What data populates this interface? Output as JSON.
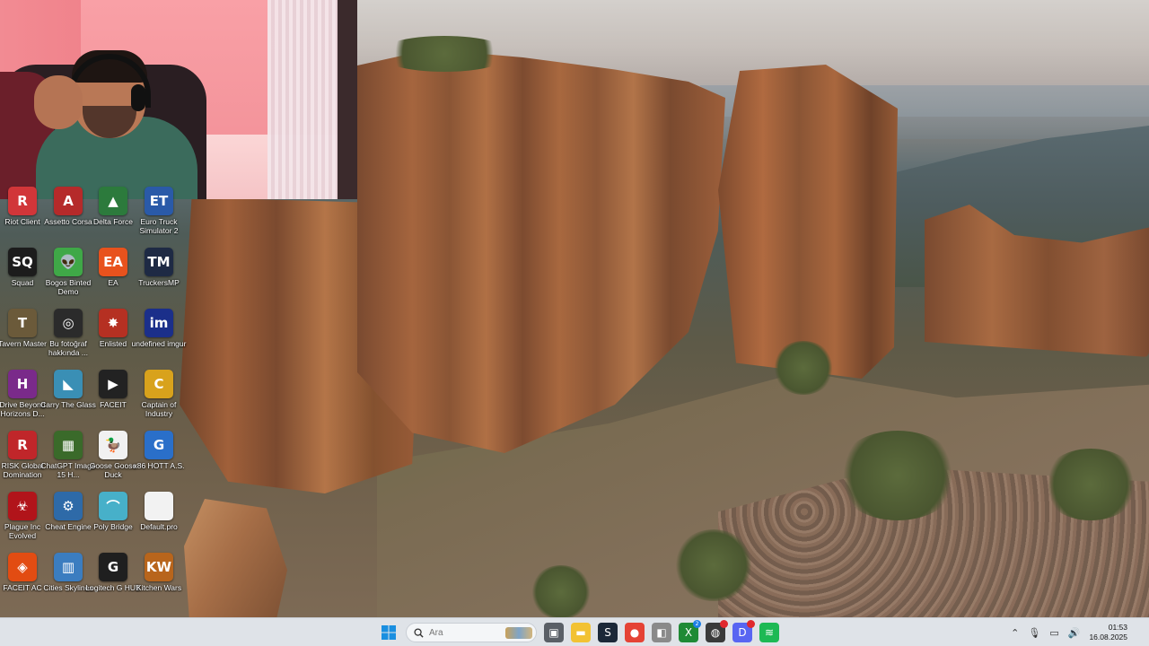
{
  "desktop_icons": [
    {
      "label": "Riot Client",
      "icon": "riot-icon",
      "color": "#d13639",
      "glyph": "R"
    },
    {
      "label": "Assetto Corsa",
      "icon": "assetto-icon",
      "color": "#b52a2a",
      "glyph": "A"
    },
    {
      "label": "Delta Force",
      "icon": "delta-force-icon",
      "color": "#2c7a3c",
      "glyph": "▲"
    },
    {
      "label": "Euro Truck Simulator 2",
      "icon": "euro-truck-icon",
      "color": "#2a5aa8",
      "glyph": "ET"
    },
    {
      "label": "Squad",
      "icon": "squad-icon",
      "color": "#1c1c1c",
      "glyph": "SQ"
    },
    {
      "label": "Bogos Binted Demo",
      "icon": "alien-icon",
      "color": "#3fa847",
      "glyph": "👽"
    },
    {
      "label": "EA",
      "icon": "ea-icon",
      "color": "#e8521d",
      "glyph": "EA"
    },
    {
      "label": "TruckersMP",
      "icon": "truckersmp-icon",
      "color": "#1e2a44",
      "glyph": "TM"
    },
    {
      "label": "Tavern Master",
      "icon": "tavern-icon",
      "color": "#6b5a3a",
      "glyph": "T"
    },
    {
      "label": "Bu fotoğraf hakkında ...",
      "icon": "camera-icon",
      "color": "#2b2b2b",
      "glyph": "◎"
    },
    {
      "label": "Enlisted",
      "icon": "enlisted-icon",
      "color": "#b53022",
      "glyph": "✸"
    },
    {
      "label": "undefined imgur",
      "icon": "imgur-icon",
      "color": "#1b2f8a",
      "glyph": "im"
    },
    {
      "label": "Drive Beyond Horizons D...",
      "icon": "drive-beyond-icon",
      "color": "#7a2a8a",
      "glyph": "H"
    },
    {
      "label": "Carry The Glass",
      "icon": "carry-glass-icon",
      "color": "#3a8fb5",
      "glyph": "◣"
    },
    {
      "label": "FACEIT",
      "icon": "faceit-icon",
      "color": "#222222",
      "glyph": "▶"
    },
    {
      "label": "Captain of Industry",
      "icon": "captain-industry-icon",
      "color": "#d8a21c",
      "glyph": "C"
    },
    {
      "label": "RISK Global Domination",
      "icon": "risk-icon",
      "color": "#c0262a",
      "glyph": "R"
    },
    {
      "label": "ChatGPT Image 15 H...",
      "icon": "image-file-icon",
      "color": "#3a6a2a",
      "glyph": "▦"
    },
    {
      "label": "Goose Goose Duck",
      "icon": "goose-icon",
      "color": "#f1f1f1",
      "glyph": "🦆"
    },
    {
      "label": "x86 HOTT A.S.",
      "icon": "x86-icon",
      "color": "#2a6fc9",
      "glyph": "G"
    },
    {
      "label": "Plague Inc Evolved",
      "icon": "plague-icon",
      "color": "#b1141a",
      "glyph": "☣"
    },
    {
      "label": "Cheat Engine",
      "icon": "cheat-engine-icon",
      "color": "#2e6aa8",
      "glyph": "⚙"
    },
    {
      "label": "Poly Bridge",
      "icon": "poly-bridge-icon",
      "color": "#47b0c9",
      "glyph": "⌒"
    },
    {
      "label": "Default.pro",
      "icon": "document-icon",
      "color": "#f2f2f2",
      "glyph": ""
    },
    {
      "label": "FACEIT AC",
      "icon": "faceit-ac-icon",
      "color": "#e24c12",
      "glyph": "◈"
    },
    {
      "label": "Cities Skylines",
      "icon": "cities-icon",
      "color": "#3b7dc0",
      "glyph": "▥"
    },
    {
      "label": "Logitech G HUB",
      "icon": "logitech-icon",
      "color": "#1f1f1f",
      "glyph": "G"
    },
    {
      "label": "Kitchen Wars",
      "icon": "kitchen-wars-icon",
      "color": "#b8651c",
      "glyph": "KW"
    }
  ],
  "taskbar": {
    "search_placeholder": "Ara",
    "apps": [
      {
        "icon": "task-view-icon",
        "color": "#5a5f66",
        "glyph": "▣"
      },
      {
        "icon": "file-explorer-icon",
        "color": "#f2c233",
        "glyph": "▬"
      },
      {
        "icon": "steam-icon",
        "color": "#1b2838",
        "glyph": "S"
      },
      {
        "icon": "chrome-icon",
        "color": "#e54335",
        "glyph": "●"
      },
      {
        "icon": "microsoft-store-icon",
        "color": "#8a8a8a",
        "glyph": "◧"
      },
      {
        "icon": "xbox-icon",
        "color": "#1f8a35",
        "glyph": "X",
        "badge": "2"
      },
      {
        "icon": "steelseries-icon",
        "color": "#3a3a3a",
        "glyph": "◍",
        "badge": "",
        "badge_red": true
      },
      {
        "icon": "discord-icon",
        "color": "#5865f2",
        "glyph": "D",
        "badge": "",
        "badge_red": true
      },
      {
        "icon": "spotify-icon",
        "color": "#1db954",
        "glyph": "≋"
      }
    ],
    "time": "01:53",
    "date": "16.08.2025"
  }
}
